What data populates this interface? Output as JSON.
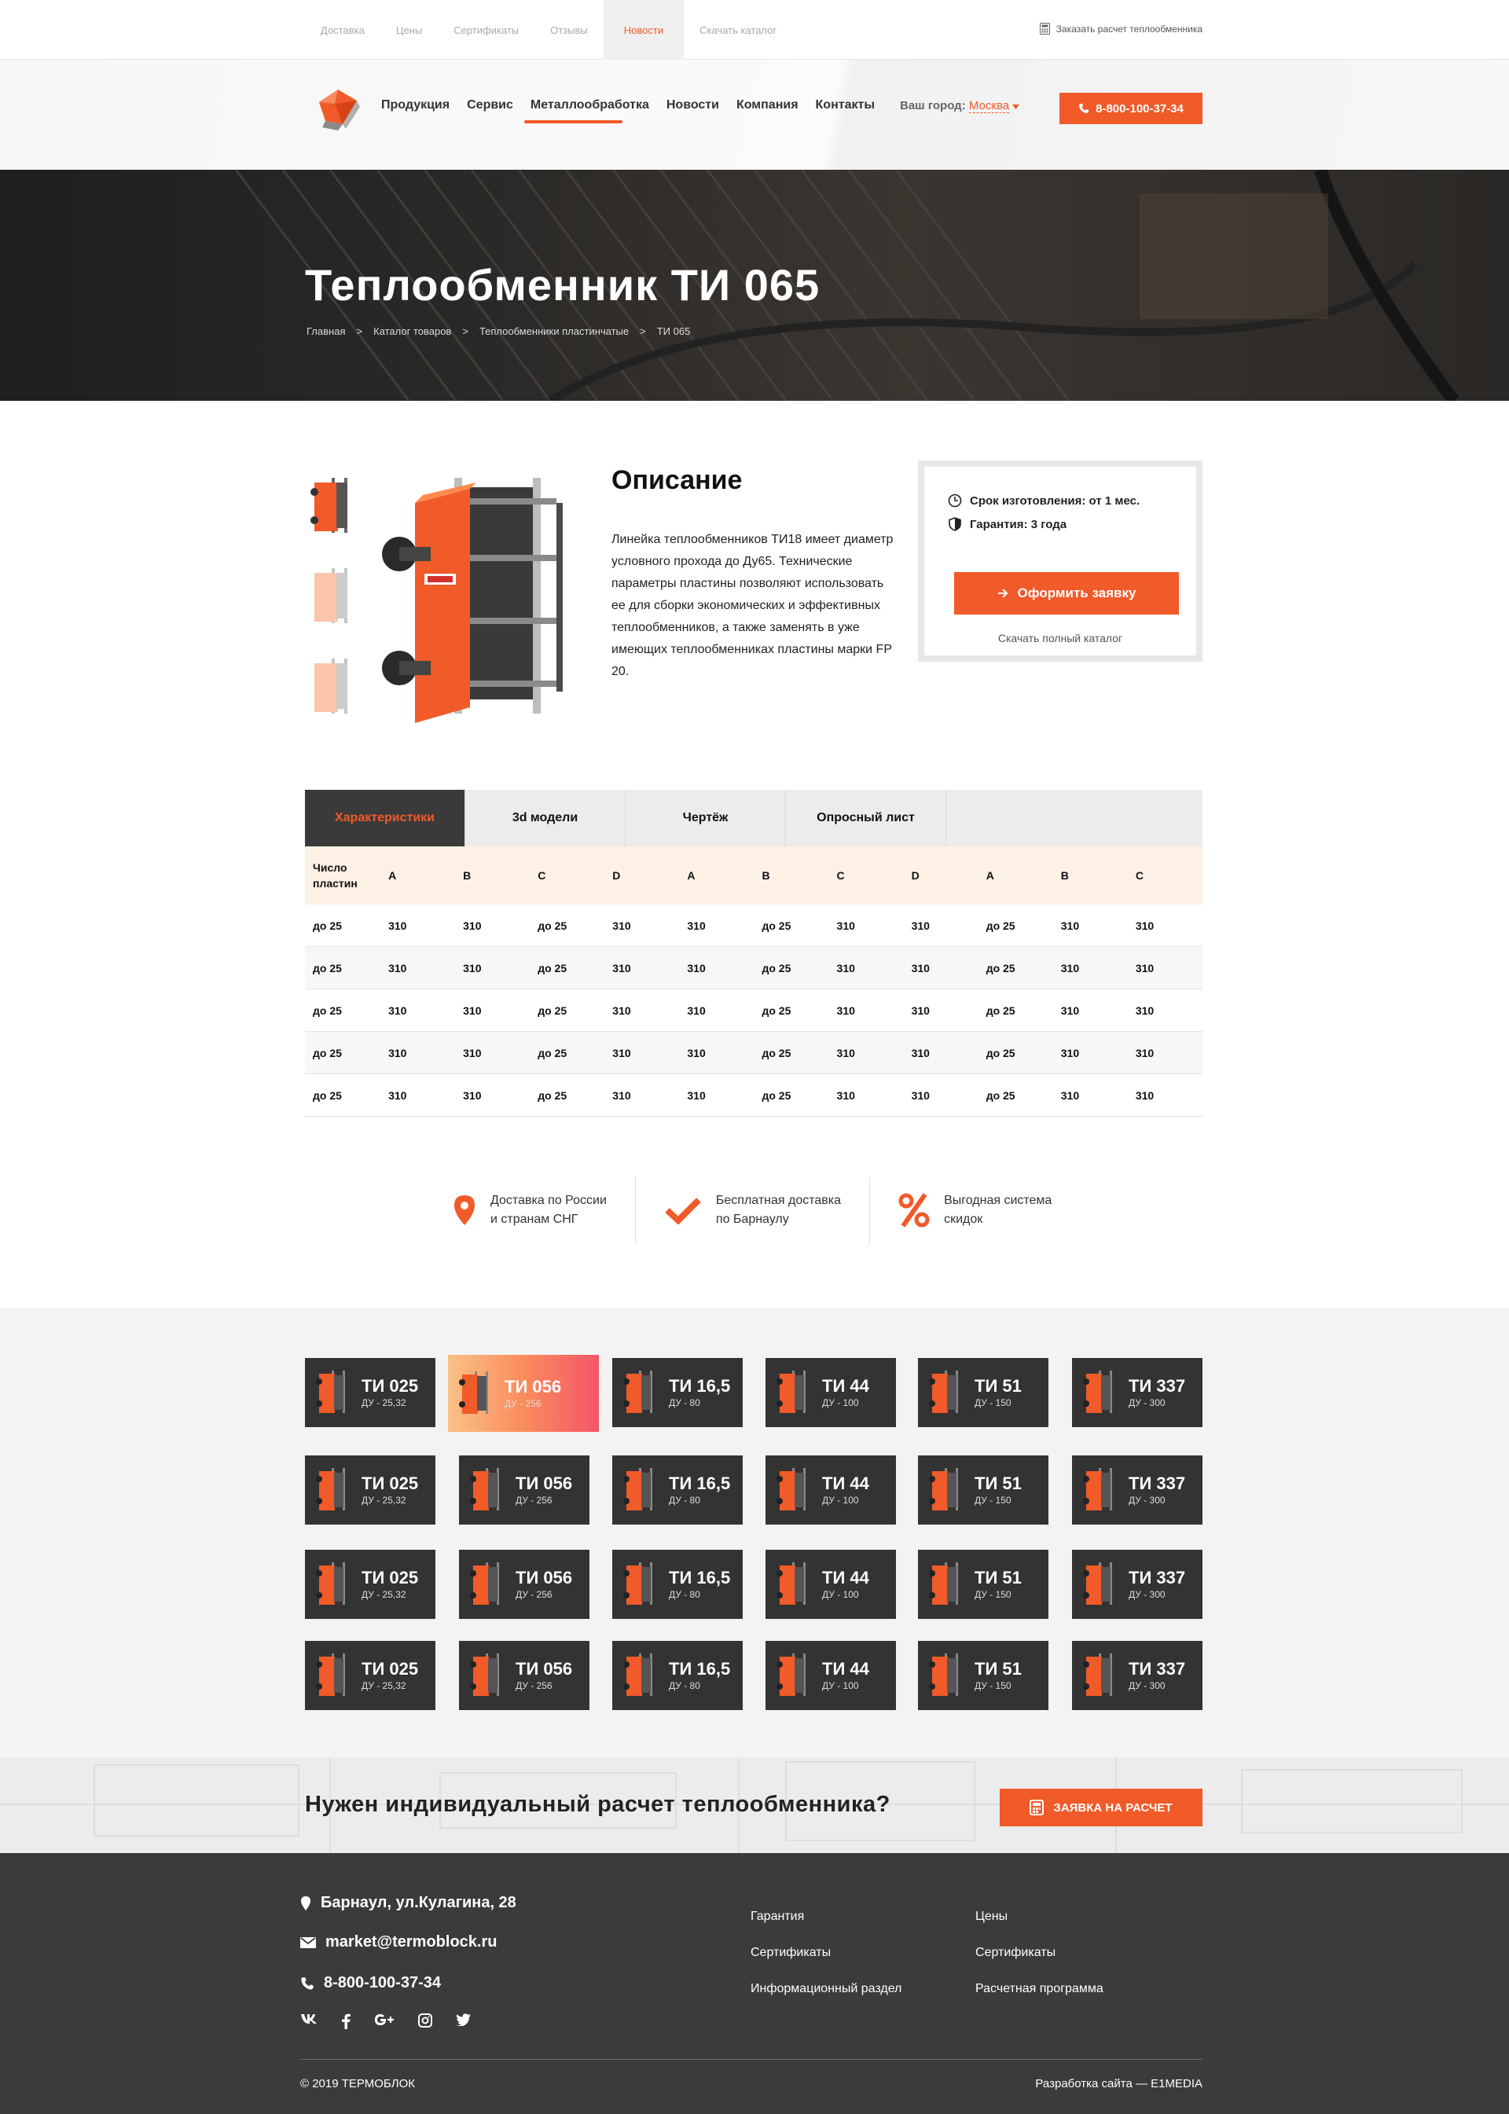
{
  "topbar": {
    "links": [
      "Доставка",
      "Цены",
      "Сертификаты",
      "Отзывы",
      "Новости",
      "Скачать каталог"
    ],
    "active_index": 4,
    "right_link": "Заказать расчет теплообменника"
  },
  "header": {
    "nav": [
      "Продукция",
      "Сервис",
      "Металлообработка",
      "Новости",
      "Компания",
      "Контакты"
    ],
    "active_index": 2,
    "city_label": "Ваш город:",
    "city_value": "Москва",
    "phone": "8-800-100-37-34"
  },
  "hero": {
    "title": "Теплообменник ТИ 065",
    "breadcrumbs": [
      "Главная",
      ">",
      "Каталог товаров",
      ">",
      "Теплообменники пластинчатые",
      ">",
      "ТИ 065"
    ]
  },
  "product": {
    "desc_title": "Описание",
    "desc_text": "Линейка теплообменников ТИ18 имеет диаметр условного прохода до Ду65. Технические параметры пластины позволяют использовать ее для сборки экономических и эффективных теплообменников, а также заменять в уже имеющих теплообменниках пластины марки FP 20.",
    "lead_time": "Срок изготовления: от 1 мес.",
    "warranty": "Гарантия: 3 года",
    "order_button": "Оформить заявку",
    "catalog_link": "Скачать полный каталог"
  },
  "tabs": [
    "Характеристики",
    "3d модели",
    "Чертёж",
    "Опросный лист"
  ],
  "table": {
    "headers": [
      "Число пластин",
      "A",
      "B",
      "C",
      "D",
      "A",
      "B",
      "C",
      "D",
      "A",
      "B",
      "C"
    ],
    "rows": [
      [
        "до 25",
        "310",
        "310",
        "до 25",
        "310",
        "310",
        "до 25",
        "310",
        "310",
        "до 25",
        "310",
        "310"
      ],
      [
        "до 25",
        "310",
        "310",
        "до 25",
        "310",
        "310",
        "до 25",
        "310",
        "310",
        "до 25",
        "310",
        "310"
      ],
      [
        "до 25",
        "310",
        "310",
        "до 25",
        "310",
        "310",
        "до 25",
        "310",
        "310",
        "до 25",
        "310",
        "310"
      ],
      [
        "до 25",
        "310",
        "310",
        "до 25",
        "310",
        "310",
        "до 25",
        "310",
        "310",
        "до 25",
        "310",
        "310"
      ],
      [
        "до 25",
        "310",
        "310",
        "до 25",
        "310",
        "310",
        "до 25",
        "310",
        "310",
        "до 25",
        "310",
        "310"
      ]
    ]
  },
  "features": [
    {
      "icon": "map-pin-icon",
      "line1": "Доставка по России",
      "line2": "и странам СНГ"
    },
    {
      "icon": "checkmark-icon",
      "line1": "Бесплатная доставка",
      "line2": "по Барнаулу"
    },
    {
      "icon": "percent-icon",
      "line1": "Выгодная система",
      "line2": "скидок"
    }
  ],
  "catalog": {
    "items": [
      {
        "name": "ТИ 025",
        "du": "ДУ - 25,32"
      },
      {
        "name": "ТИ 056",
        "du": "ДУ - 256"
      },
      {
        "name": "ТИ 16,5",
        "du": "ДУ - 80"
      },
      {
        "name": "ТИ 44",
        "du": "ДУ - 100"
      },
      {
        "name": "ТИ 51",
        "du": "ДУ - 150"
      },
      {
        "name": "ТИ 337",
        "du": "ДУ - 300"
      }
    ],
    "rows": 4
  },
  "cta": {
    "title": "Нужен индивидуальный расчет теплообменника?",
    "button": "ЗАЯВКА НА РАСЧЕТ"
  },
  "footer": {
    "address": "Барнаул, ул.Кулагина, 28",
    "email": "market@termoblock.ru",
    "phone": "8-800-100-37-34",
    "col1": [
      "Гарантия",
      "Сертификаты",
      "Информационный раздел"
    ],
    "col2": [
      "Цены",
      "Сертификаты",
      "Расчетная программа"
    ],
    "copyright": "© 2019 ТЕРМОБЛОК",
    "developer": "Разработка сайта — E1MEDIA"
  },
  "colors": {
    "accent": "#f15a29",
    "dark": "#3b3b3b",
    "table_head": "#fdf1e6"
  }
}
